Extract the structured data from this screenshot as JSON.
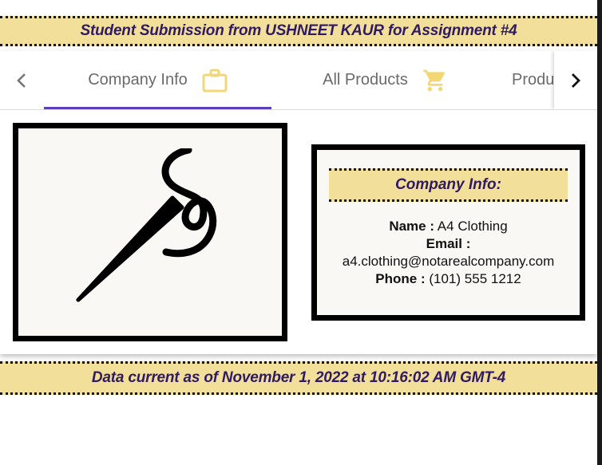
{
  "header": {
    "banner_text": "Student Submission from USHNEET KAUR for Assignment #4"
  },
  "tabs": [
    {
      "label": "Company Info",
      "icon": "briefcase-icon",
      "active": true
    },
    {
      "label": "All Products",
      "icon": "cart-icon",
      "active": false
    },
    {
      "label": "Produ",
      "icon": "",
      "active": false
    }
  ],
  "nav": {
    "prev_icon": "chevron-left-icon",
    "next_icon": "chevron-right-icon"
  },
  "company": {
    "logo_icon": "needle-thread-icon",
    "heading": "Company Info:",
    "name_label": "Name :",
    "name_value": "A4 Clothing",
    "email_label": "Email :",
    "email_value": "a4.clothing@notarealcompany.com",
    "phone_label": "Phone :",
    "phone_value": "(101) 555 1212"
  },
  "footer": {
    "banner_text": "Data current as of November 1, 2022 at 10:16:02 AM GMT-4"
  },
  "colors": {
    "banner_bg": "#f2df9a",
    "banner_text": "#2f1a63",
    "tab_indicator": "#5b3fbd",
    "icon_yellow": "#f2d774"
  }
}
